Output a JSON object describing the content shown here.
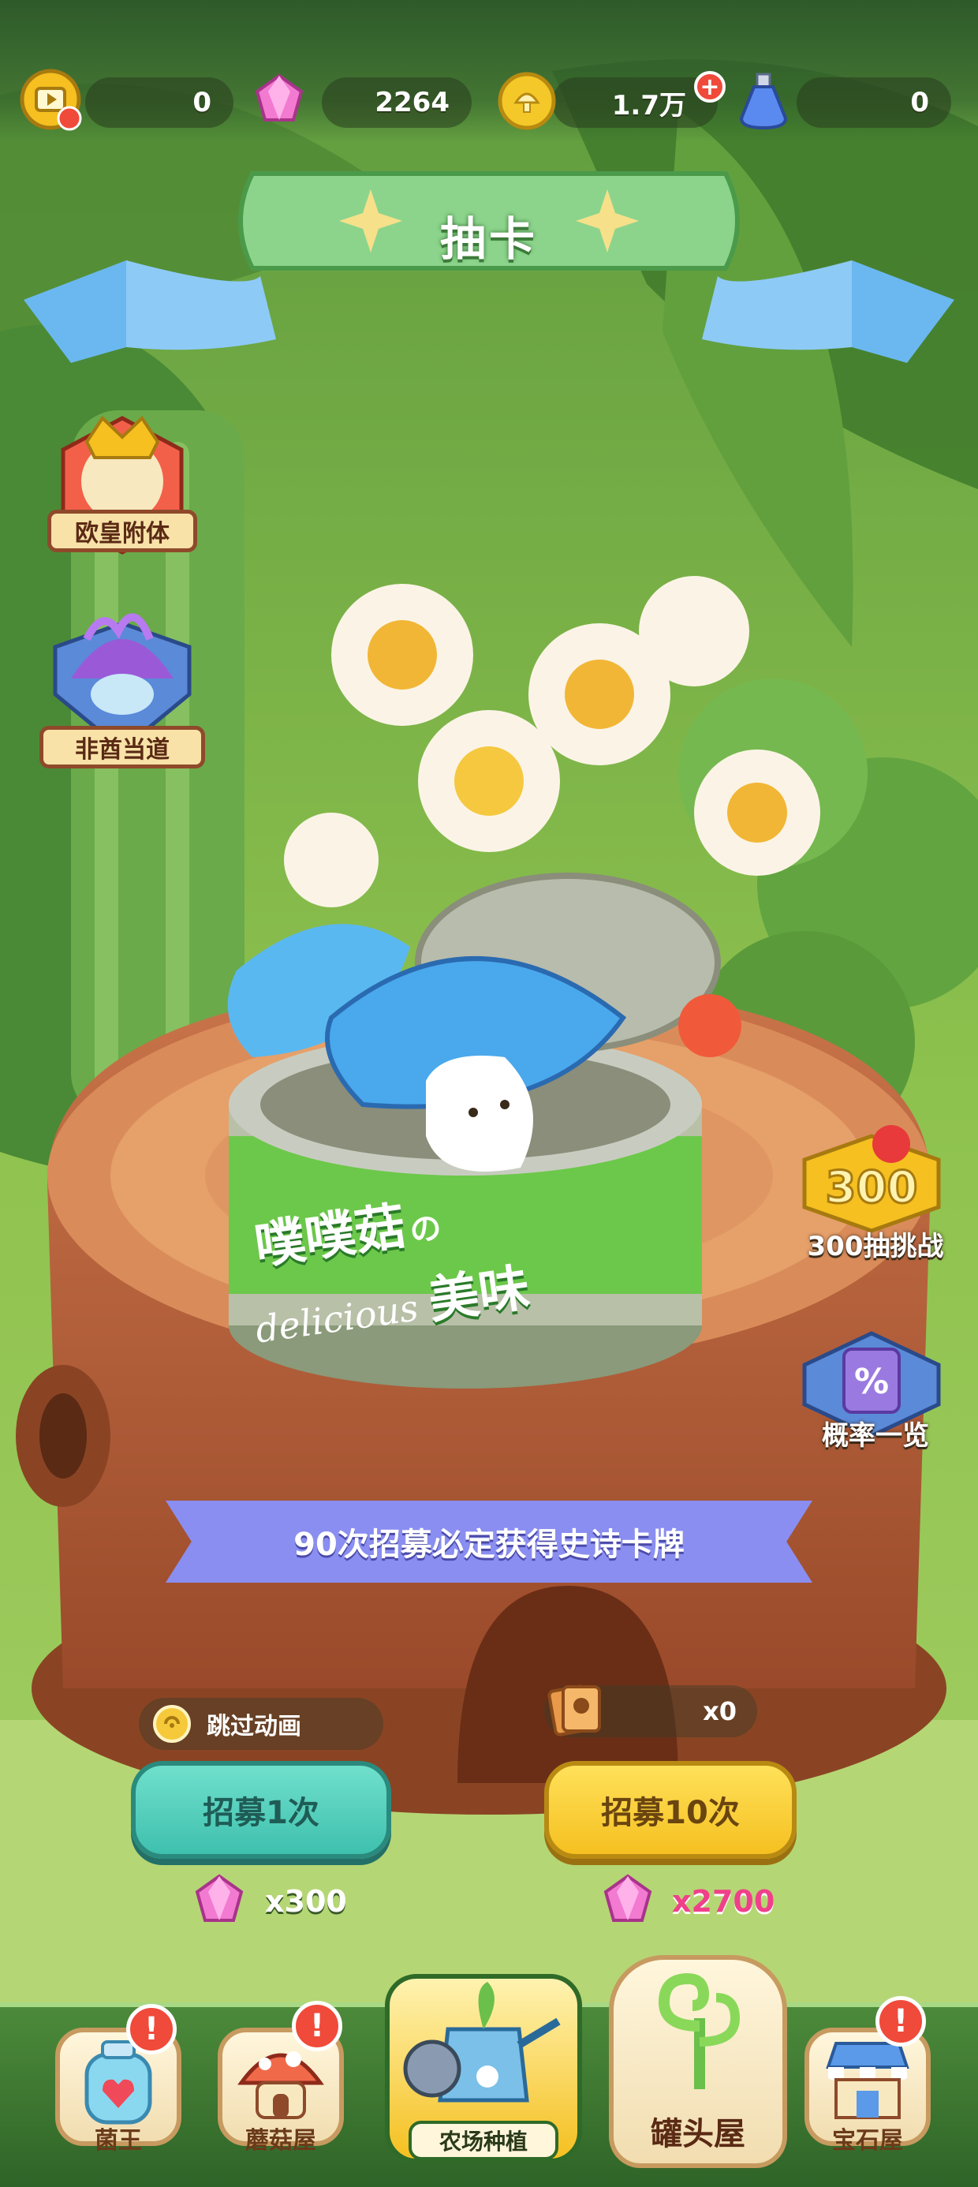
{
  "resources": [
    {
      "icon": "video-ad-icon",
      "value": "0"
    },
    {
      "icon": "pink-gem-icon",
      "value": "2264"
    },
    {
      "icon": "gold-coin-icon",
      "value": "1.7万",
      "plus": "+"
    },
    {
      "icon": "potion-bottle-icon",
      "value": "0"
    }
  ],
  "title": "抽卡",
  "left_events": [
    {
      "label": "欧皇附体",
      "icon": "crown-king-icon"
    },
    {
      "label": "非酋当道",
      "icon": "purple-mushroom-icon"
    }
  ],
  "right_buttons": [
    {
      "label": "300抽挑战",
      "badge": "300",
      "icon": "mushroom-300-badge-icon"
    },
    {
      "label": "概率一览",
      "badge": "%",
      "icon": "probability-scroll-icon"
    }
  ],
  "can_label": {
    "line1": "噗噗菇",
    "connector": "の",
    "line2": "美味",
    "script": "delicious"
  },
  "guarantee_text": "90次招募必定获得史诗卡牌",
  "skip_animation": "跳过动画",
  "ticket_count": "x0",
  "recruit": {
    "one": {
      "label": "招募1次",
      "cost": "x300"
    },
    "ten": {
      "label": "招募10次",
      "cost": "x2700"
    }
  },
  "nav": [
    {
      "label": "菌王",
      "alert": "!"
    },
    {
      "label": "蘑菇屋",
      "alert": "!"
    },
    {
      "label": "农场种植",
      "active": true
    },
    {
      "label": "罐头屋"
    },
    {
      "label": "宝石屋",
      "alert": "!"
    }
  ],
  "colors": {
    "teal_button": "#3fc0ae",
    "yellow_button": "#f5c020",
    "banner_purple": "#8a8ef0",
    "cost_one": "#ffffff",
    "cost_ten": "#f0408a"
  }
}
